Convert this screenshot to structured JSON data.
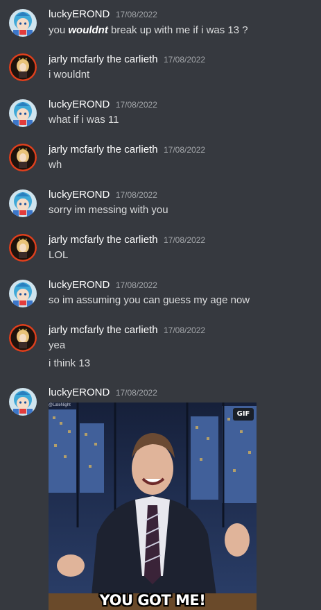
{
  "channel": {
    "messages": [
      {
        "author": "luckyEROND",
        "timestamp": "17/08/2022",
        "avatar_icon": "cirno-avatar-icon",
        "lines": [
          {
            "prefix": "you ",
            "emphasis": "wouldnt",
            "suffix": " break up with me if i was 13 ?"
          }
        ]
      },
      {
        "author": "jarly mcfarly the carlieth",
        "timestamp": "17/08/2022",
        "avatar_icon": "anime-girl-avatar-icon",
        "lines": [
          {
            "text": "i wouldnt"
          }
        ]
      },
      {
        "author": "luckyEROND",
        "timestamp": "17/08/2022",
        "avatar_icon": "cirno-avatar-icon",
        "lines": [
          {
            "text": "what if i was 11"
          }
        ]
      },
      {
        "author": "jarly mcfarly the carlieth",
        "timestamp": "17/08/2022",
        "avatar_icon": "anime-girl-avatar-icon",
        "lines": [
          {
            "text": "wh"
          }
        ]
      },
      {
        "author": "luckyEROND",
        "timestamp": "17/08/2022",
        "avatar_icon": "cirno-avatar-icon",
        "lines": [
          {
            "text": "sorry im messing with you"
          }
        ]
      },
      {
        "author": "jarly mcfarly the carlieth",
        "timestamp": "17/08/2022",
        "avatar_icon": "anime-girl-avatar-icon",
        "lines": [
          {
            "text": "LOL"
          }
        ]
      },
      {
        "author": "luckyEROND",
        "timestamp": "17/08/2022",
        "avatar_icon": "cirno-avatar-icon",
        "lines": [
          {
            "text": "so im assuming you can guess my age now"
          }
        ]
      },
      {
        "author": "jarly mcfarly the carlieth",
        "timestamp": "17/08/2022",
        "avatar_icon": "anime-girl-avatar-icon",
        "lines": [
          {
            "text": "yea"
          },
          {
            "text": "i think 13"
          }
        ]
      },
      {
        "author": "luckyEROND",
        "timestamp": "17/08/2022",
        "avatar_icon": "cirno-avatar-icon",
        "attachment": {
          "type": "gif",
          "badge": "GIF",
          "credit": "@LateNight",
          "caption": "YOU GOT ME!"
        }
      }
    ]
  },
  "colors": {
    "background": "#36393f",
    "username": "#ffffff",
    "timestamp": "#a3a6aa",
    "message_text": "#dcddde"
  }
}
